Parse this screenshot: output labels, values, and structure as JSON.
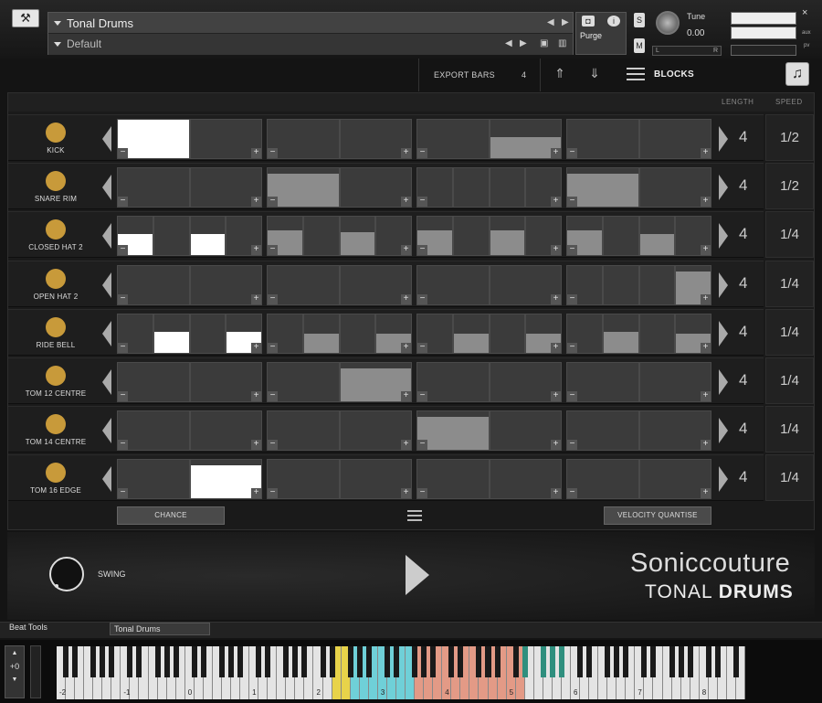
{
  "header": {
    "instrument_name": "Tonal Drums",
    "preset_name": "Default",
    "purge_label": "Purge",
    "solo_label": "S",
    "mute_label": "M",
    "tune_label": "Tune",
    "tune_value": "0.00",
    "pan_left": "L",
    "pan_right": "R",
    "close_label": "×",
    "aux_label": "aux",
    "pv_label": "pv"
  },
  "toolbar": {
    "export_bars_label": "EXPORT BARS",
    "export_bars_value": "4",
    "blocks_label": "BLOCKS"
  },
  "columns": {
    "length": "LENGTH",
    "speed": "SPEED"
  },
  "tracks": [
    {
      "name": "KICK",
      "length": "4",
      "speed": "1/2",
      "bars": [
        [
          {
            "v": 1,
            "c": "w"
          },
          {
            "v": 0
          }
        ],
        [
          {
            "v": 0
          },
          {
            "v": 0
          }
        ],
        [
          {
            "v": 0
          },
          {
            "v": 0.55,
            "c": "g"
          }
        ],
        [
          {
            "v": 0
          },
          {
            "v": 0
          }
        ]
      ]
    },
    {
      "name": "SNARE RIM",
      "length": "4",
      "speed": "1/2",
      "bars": [
        [
          {
            "v": 0
          },
          {
            "v": 0
          }
        ],
        [
          {
            "v": 0.85,
            "c": "g"
          },
          {
            "v": 0
          }
        ],
        [
          {
            "v": 0
          },
          {
            "v": 0
          },
          {
            "v": 0
          },
          {
            "v": 0
          }
        ],
        [
          {
            "v": 0.85,
            "c": "g"
          },
          {
            "v": 0
          }
        ]
      ]
    },
    {
      "name": "CLOSED HAT 2",
      "length": "4",
      "speed": "1/4",
      "bars": [
        [
          {
            "v": 0.55,
            "c": "w"
          },
          {
            "v": 0
          },
          {
            "v": 0.55,
            "c": "w"
          },
          {
            "v": 0
          }
        ],
        [
          {
            "v": 0.65,
            "c": "g"
          },
          {
            "v": 0
          },
          {
            "v": 0.6,
            "c": "g"
          },
          {
            "v": 0
          }
        ],
        [
          {
            "v": 0.65,
            "c": "g"
          },
          {
            "v": 0
          },
          {
            "v": 0.65,
            "c": "g"
          },
          {
            "v": 0
          }
        ],
        [
          {
            "v": 0.65,
            "c": "g"
          },
          {
            "v": 0
          },
          {
            "v": 0.55,
            "c": "g"
          },
          {
            "v": 0
          }
        ]
      ]
    },
    {
      "name": "OPEN HAT 2",
      "length": "4",
      "speed": "1/4",
      "bars": [
        [
          {
            "v": 0
          },
          {
            "v": 0
          }
        ],
        [
          {
            "v": 0
          },
          {
            "v": 0
          }
        ],
        [
          {
            "v": 0
          },
          {
            "v": 0
          }
        ],
        [
          {
            "v": 0
          },
          {
            "v": 0
          },
          {
            "v": 0
          },
          {
            "v": 0.85,
            "c": "g"
          }
        ]
      ]
    },
    {
      "name": "RIDE BELL",
      "length": "4",
      "speed": "1/4",
      "bars": [
        [
          {
            "v": 0
          },
          {
            "v": 0.55,
            "c": "w"
          },
          {
            "v": 0
          },
          {
            "v": 0.55,
            "c": "w"
          }
        ],
        [
          {
            "v": 0
          },
          {
            "v": 0.5,
            "c": "g"
          },
          {
            "v": 0
          },
          {
            "v": 0.5,
            "c": "g"
          }
        ],
        [
          {
            "v": 0
          },
          {
            "v": 0.5,
            "c": "g"
          },
          {
            "v": 0
          },
          {
            "v": 0.5,
            "c": "g"
          }
        ],
        [
          {
            "v": 0
          },
          {
            "v": 0.55,
            "c": "g"
          },
          {
            "v": 0
          },
          {
            "v": 0.5,
            "c": "g"
          }
        ]
      ]
    },
    {
      "name": "TOM 12 CENTRE",
      "length": "4",
      "speed": "1/4",
      "bars": [
        [
          {
            "v": 0
          },
          {
            "v": 0
          }
        ],
        [
          {
            "v": 0
          },
          {
            "v": 0.85,
            "c": "g"
          }
        ],
        [
          {
            "v": 0
          },
          {
            "v": 0
          }
        ],
        [
          {
            "v": 0
          },
          {
            "v": 0
          }
        ]
      ]
    },
    {
      "name": "TOM 14 CENTRE",
      "length": "4",
      "speed": "1/4",
      "bars": [
        [
          {
            "v": 0
          },
          {
            "v": 0
          }
        ],
        [
          {
            "v": 0
          },
          {
            "v": 0
          }
        ],
        [
          {
            "v": 0.85,
            "c": "g"
          },
          {
            "v": 0
          }
        ],
        [
          {
            "v": 0
          },
          {
            "v": 0
          }
        ]
      ]
    },
    {
      "name": "TOM 16 EDGE",
      "length": "4",
      "speed": "1/4",
      "bars": [
        [
          {
            "v": 0
          },
          {
            "v": 0.85,
            "c": "w"
          }
        ],
        [
          {
            "v": 0
          },
          {
            "v": 0
          }
        ],
        [
          {
            "v": 0
          },
          {
            "v": 0
          }
        ],
        [
          {
            "v": 0
          },
          {
            "v": 0
          }
        ]
      ]
    }
  ],
  "buttons": {
    "chance": "CHANCE",
    "velocity_quantise": "VELOCITY QUANTISE"
  },
  "swing_label": "SWING",
  "brand": {
    "line1": "Soniccouture",
    "line2_light": "TONAL ",
    "line2_bold": "DRUMS"
  },
  "tabs": {
    "tab1": "Beat Tools",
    "tab2": "Tonal Drums"
  },
  "keyboard": {
    "octave_offset": "+0",
    "octave_labels": [
      "-2",
      "-1",
      "0",
      "1",
      "2",
      "3",
      "4",
      "5",
      "6",
      "7",
      "8"
    ],
    "colors": {
      "yellow": "#e8d34a",
      "cyan": "#6fd0d8",
      "salmon": "#e39a86",
      "teal": "#2f8f7e"
    }
  },
  "colors": {
    "accent_dot": "#c89a3a",
    "step_white": "#ffffff",
    "step_gray": "#8c8c8c"
  }
}
